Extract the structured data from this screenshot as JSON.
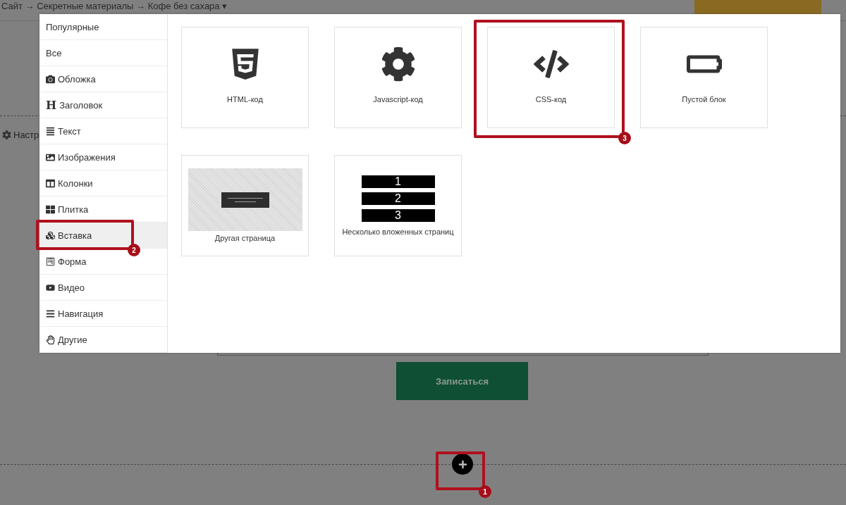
{
  "breadcrumb": {
    "text": "Сайт → Секретные материалы → Кофе без сахара",
    "caret": "▾"
  },
  "settings_link": "Настр",
  "submit_button": "Записаться",
  "sidebar": [
    {
      "label": "Популярные",
      "kind": "plain",
      "selected": false
    },
    {
      "label": "Все",
      "kind": "plain",
      "selected": false
    },
    {
      "label": "Обложка",
      "kind": "camera",
      "selected": false
    },
    {
      "label": "Заголовок",
      "kind": "glyph",
      "glyph": "H",
      "selected": false
    },
    {
      "label": "Текст",
      "kind": "lines",
      "selected": false
    },
    {
      "label": "Изображения",
      "kind": "image",
      "selected": false
    },
    {
      "label": "Колонки",
      "kind": "columns",
      "selected": false
    },
    {
      "label": "Плитка",
      "kind": "tiles",
      "selected": false
    },
    {
      "label": "Вставка",
      "kind": "cubes",
      "selected": true
    },
    {
      "label": "Форма",
      "kind": "form",
      "selected": false
    },
    {
      "label": "Видео",
      "kind": "video",
      "selected": false
    },
    {
      "label": "Навигация",
      "kind": "menu",
      "selected": false
    },
    {
      "label": "Другие",
      "kind": "hand",
      "selected": false
    }
  ],
  "blocks": [
    {
      "label": "HTML-код",
      "kind": "html5"
    },
    {
      "label": "Javascript-код",
      "kind": "gear"
    },
    {
      "label": "CSS-код",
      "kind": "code"
    },
    {
      "label": "Пустой блок",
      "kind": "battery"
    },
    {
      "label": "Другая страница",
      "kind": "page-preview"
    },
    {
      "label": "Несколько вложенных страниц",
      "kind": "nested-pages",
      "labels": [
        "1",
        "2",
        "3"
      ]
    }
  ],
  "annotations": [
    {
      "number": "1"
    },
    {
      "number": "2"
    },
    {
      "number": "3"
    }
  ]
}
